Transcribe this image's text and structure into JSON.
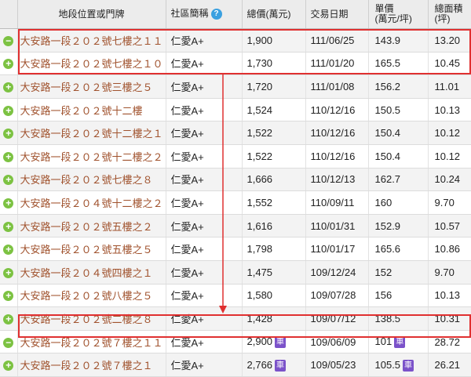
{
  "headers": {
    "address": "地段位置或門牌",
    "community": "社區簡稱",
    "total_price": "總價(萬元)",
    "date": "交易日期",
    "unit_price": "單價\n(萬元/坪)",
    "area": "總面積\n(坪)"
  },
  "help_glyph": "?",
  "car_label": "車",
  "rows": [
    {
      "expand": "−",
      "address": "大安路一段２０２號七樓之１１",
      "community": "仁愛A+",
      "total": "1,900",
      "date": "111/06/25",
      "unit": "143.9",
      "area": "13.20",
      "car_total": false,
      "car_unit": false
    },
    {
      "expand": "+",
      "address": "大安路一段２０２號七樓之１０",
      "community": "仁愛A+",
      "total": "1,730",
      "date": "111/01/20",
      "unit": "165.5",
      "area": "10.45",
      "car_total": false,
      "car_unit": false
    },
    {
      "expand": "+",
      "address": "大安路一段２０２號三樓之５",
      "community": "仁愛A+",
      "total": "1,720",
      "date": "111/01/08",
      "unit": "156.2",
      "area": "11.01",
      "car_total": false,
      "car_unit": false
    },
    {
      "expand": "+",
      "address": "大安路一段２０２號十二樓",
      "community": "仁愛A+",
      "total": "1,524",
      "date": "110/12/16",
      "unit": "150.5",
      "area": "10.13",
      "car_total": false,
      "car_unit": false
    },
    {
      "expand": "+",
      "address": "大安路一段２０２號十二樓之１",
      "community": "仁愛A+",
      "total": "1,522",
      "date": "110/12/16",
      "unit": "150.4",
      "area": "10.12",
      "car_total": false,
      "car_unit": false
    },
    {
      "expand": "+",
      "address": "大安路一段２０２號十二樓之２",
      "community": "仁愛A+",
      "total": "1,522",
      "date": "110/12/16",
      "unit": "150.4",
      "area": "10.12",
      "car_total": false,
      "car_unit": false
    },
    {
      "expand": "+",
      "address": "大安路一段２０２號七樓之８",
      "community": "仁愛A+",
      "total": "1,666",
      "date": "110/12/13",
      "unit": "162.7",
      "area": "10.24",
      "car_total": false,
      "car_unit": false
    },
    {
      "expand": "+",
      "address": "大安路一段２０４號十二樓之２",
      "community": "仁愛A+",
      "total": "1,552",
      "date": "110/09/11",
      "unit": "160",
      "area": "9.70",
      "car_total": false,
      "car_unit": false
    },
    {
      "expand": "+",
      "address": "大安路一段２０２號五樓之２",
      "community": "仁愛A+",
      "total": "1,616",
      "date": "110/01/31",
      "unit": "152.9",
      "area": "10.57",
      "car_total": false,
      "car_unit": false
    },
    {
      "expand": "+",
      "address": "大安路一段２０２號五樓之５",
      "community": "仁愛A+",
      "total": "1,798",
      "date": "110/01/17",
      "unit": "165.6",
      "area": "10.86",
      "car_total": false,
      "car_unit": false
    },
    {
      "expand": "+",
      "address": "大安路一段２０４號四樓之１",
      "community": "仁愛A+",
      "total": "1,475",
      "date": "109/12/24",
      "unit": "152",
      "area": "9.70",
      "car_total": false,
      "car_unit": false
    },
    {
      "expand": "+",
      "address": "大安路一段２０２號八樓之５",
      "community": "仁愛A+",
      "total": "1,580",
      "date": "109/07/28",
      "unit": "156",
      "area": "10.13",
      "car_total": false,
      "car_unit": false
    },
    {
      "expand": "+",
      "address": "大安路一段２０２號二樓之８",
      "community": "仁愛A+",
      "total": "1,428",
      "date": "109/07/12",
      "unit": "138.5",
      "area": "10.31",
      "car_total": false,
      "car_unit": false
    },
    {
      "expand": "−",
      "address": "大安路一段２０２號７樓之１１",
      "community": "仁愛A+",
      "total": "2,900",
      "date": "109/06/09",
      "unit": "101",
      "area": "28.72",
      "car_total": true,
      "car_unit": true
    },
    {
      "expand": "+",
      "address": "大安路一段２０２號７樓之１",
      "community": "仁愛A+",
      "total": "2,766",
      "date": "109/05/23",
      "unit": "105.5",
      "area": "26.21",
      "car_total": true,
      "car_unit": true
    }
  ]
}
